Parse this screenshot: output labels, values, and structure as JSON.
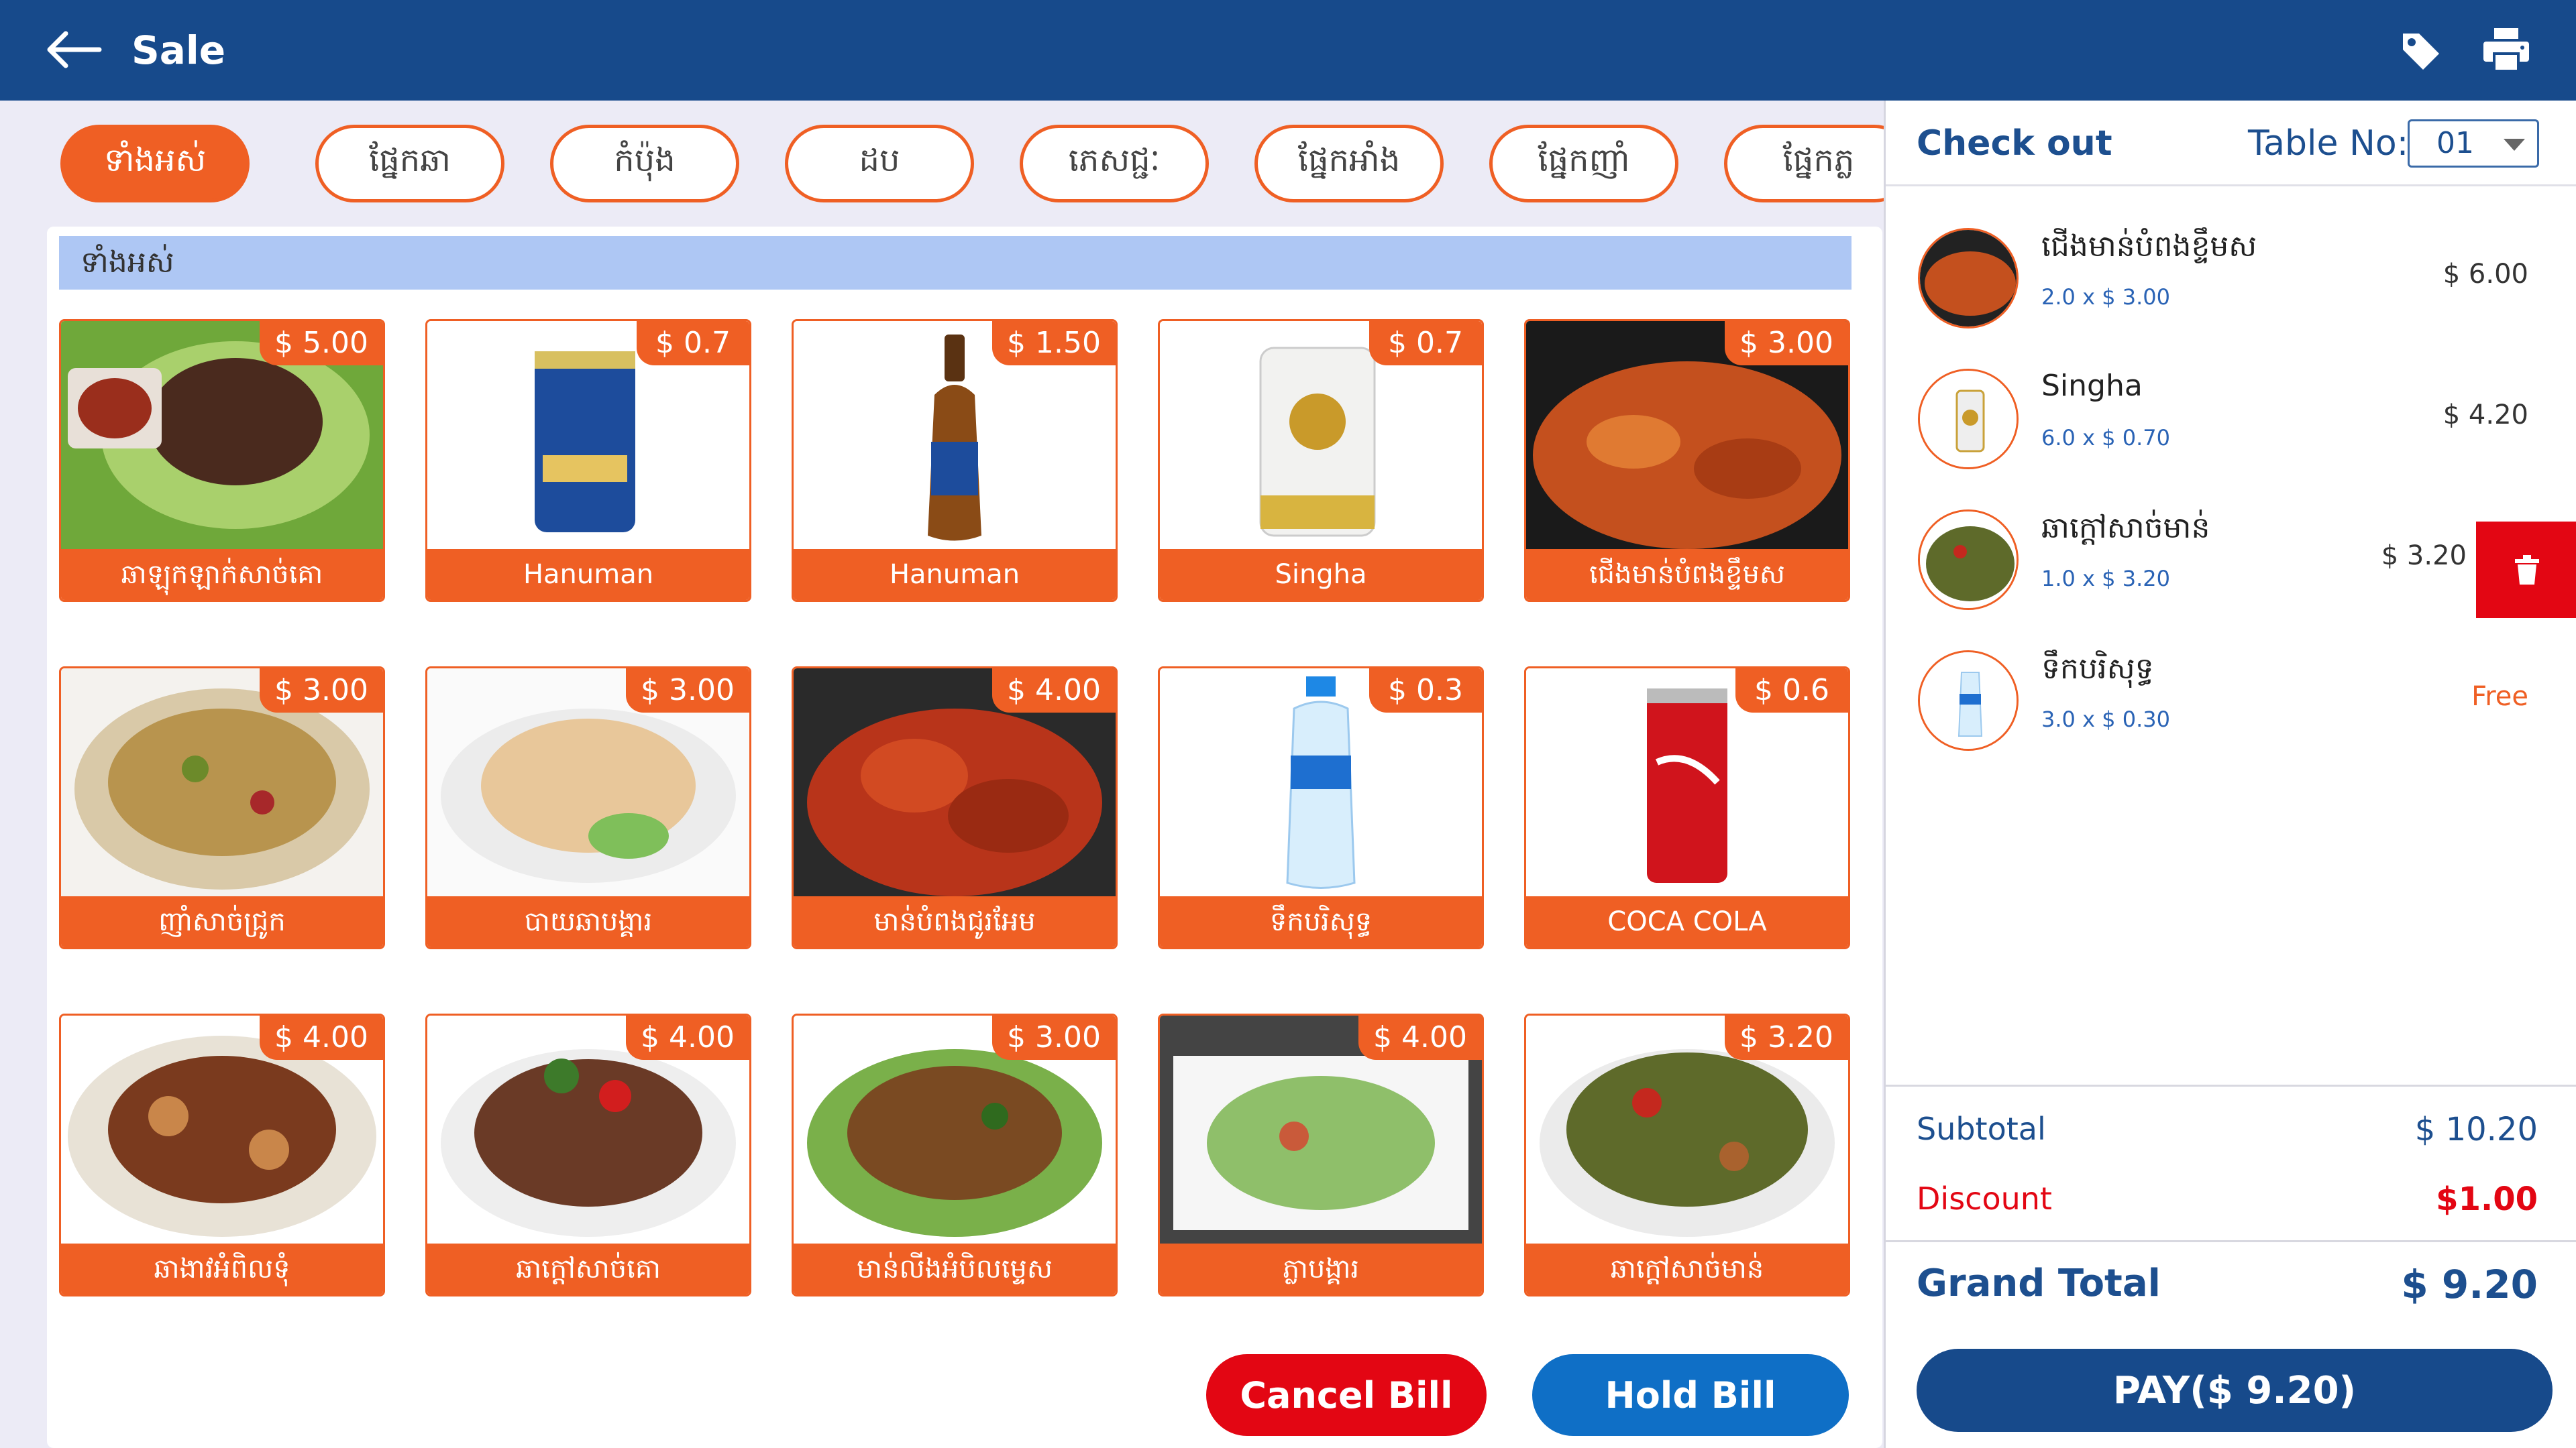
{
  "header": {
    "title": "Sale",
    "back_icon": "arrow-left-icon",
    "tag_icon": "tag-icon",
    "print_icon": "printer-icon"
  },
  "categories": [
    "ទាំងអស់",
    "ផ្នែកឆា",
    "កំប៉ុង",
    "ដប",
    "ភេសជ្ជៈ",
    "ផ្នែកអាំង",
    "ផ្នែកញាំ",
    "ផ្នែកភ្ល"
  ],
  "active_category": 0,
  "section_title": "ទាំងអស់",
  "products": [
    {
      "name": "ឆាឡុកឡាក់សាច់គោ",
      "price": "$ 5.00"
    },
    {
      "name": "Hanuman",
      "price": "$ 0.7"
    },
    {
      "name": "Hanuman",
      "price": "$ 1.50"
    },
    {
      "name": "Singha",
      "price": "$ 0.7"
    },
    {
      "name": "ជើងមាន់បំពងខ្ទឹមស",
      "price": "$ 3.00"
    },
    {
      "name": "ញាំសាច់ជ្រូក",
      "price": "$ 3.00"
    },
    {
      "name": "បាយឆាបង្គារ",
      "price": "$ 3.00"
    },
    {
      "name": "មាន់បំពងជូរអែម",
      "price": "$ 4.00"
    },
    {
      "name": "ទឹកបរិសុទ្ធ",
      "price": "$ 0.3"
    },
    {
      "name": "COCA COLA",
      "price": "$ 0.6"
    },
    {
      "name": "ឆាងាវអំពិលទុំ",
      "price": "$ 4.00"
    },
    {
      "name": "ឆាក្តៅសាច់គោ",
      "price": "$ 4.00"
    },
    {
      "name": "មាន់លីងអំបិលម្ទេស",
      "price": "$ 3.00"
    },
    {
      "name": "ភ្លាបង្គារ",
      "price": "$ 4.00"
    },
    {
      "name": "ឆាក្តៅសាច់មាន់",
      "price": "$ 3.20"
    }
  ],
  "buttons": {
    "cancel": "Cancel Bill",
    "hold": "Hold Bill",
    "pay": "PAY($ 9.20)"
  },
  "checkout": {
    "title": "Check out",
    "table_label": "Table No:",
    "table_value": "01",
    "items": [
      {
        "name": "ជើងមាន់បំពងខ្ទឹមស",
        "qty": "2.0 x $ 3.00",
        "price": "$ 6.00"
      },
      {
        "name": "Singha",
        "qty": "6.0 x $ 0.70",
        "price": "$ 4.20"
      },
      {
        "name": "ឆាក្តៅសាច់មាន់",
        "qty": "1.0 x $ 3.20",
        "price": "$ 3.20"
      },
      {
        "name": "ទឹកបរិសុទ្ធ",
        "qty": "3.0 x $ 0.30",
        "price": "Free"
      }
    ],
    "subtotal_label": "Subtotal",
    "subtotal": "$ 10.20",
    "discount_label": "Discount",
    "discount": "$1.00",
    "grand_label": "Grand Total",
    "grand": "$ 9.20"
  },
  "colors": {
    "primary": "#174a8b",
    "accent": "#ef5f24",
    "danger": "#e30613",
    "hold": "#0f6fc6"
  }
}
